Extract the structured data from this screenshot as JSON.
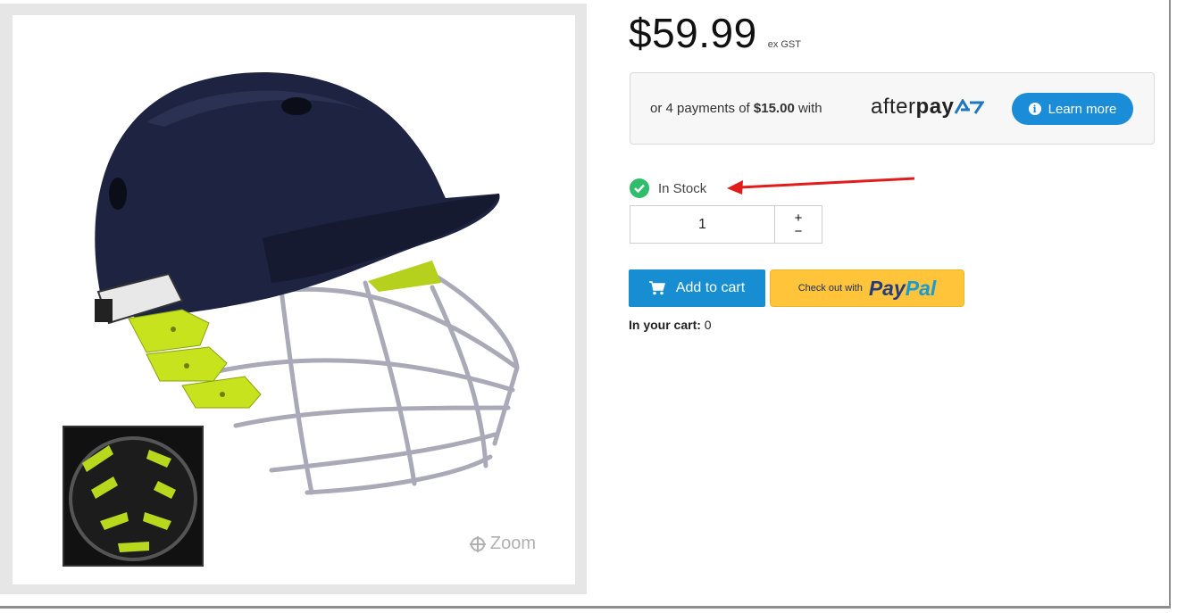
{
  "product": {
    "price": "$59.99",
    "tax_note": "ex GST",
    "zoom_label": "Zoom"
  },
  "afterpay": {
    "prefix": "or 4 payments of",
    "amount": "$15.00",
    "suffix": "with",
    "brand_light": "after",
    "brand_bold": "pay",
    "learn_more": "Learn more"
  },
  "stock": {
    "status": "In Stock"
  },
  "quantity": {
    "value": "1",
    "increment": "+",
    "decrement": "−"
  },
  "actions": {
    "add_to_cart": "Add to cart",
    "paypal_prefix": "Check out with",
    "paypal_pay": "Pay",
    "paypal_pal": "Pal"
  },
  "cart": {
    "label": "In your cart:",
    "count": "0"
  },
  "colors": {
    "primary_button": "#168ed1",
    "paypal_yellow": "#ffc43a",
    "stock_green": "#2ebd6b",
    "annotation_arrow": "#e21b1b"
  }
}
